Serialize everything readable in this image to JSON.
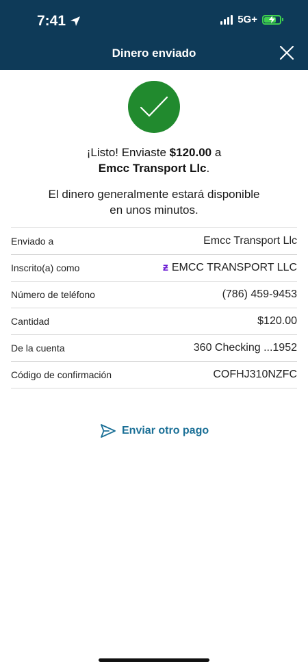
{
  "status_bar": {
    "time": "7:41",
    "network": "5G+",
    "icons": [
      "location-arrow-icon",
      "signal-icon",
      "battery-charging-icon"
    ]
  },
  "header": {
    "title": "Dinero enviado",
    "close_icon": "close-icon"
  },
  "confirmation": {
    "icon": "check-icon",
    "line1_prefix": "¡Listo! Enviaste ",
    "amount": "$120.00",
    "line1_suffix": " a",
    "recipient": "Emcc Transport Llc",
    "line2_suffix": ".",
    "availability_line1": "El dinero generalmente estará disponible",
    "availability_line2": "en unos minutos."
  },
  "details": [
    {
      "label": "Enviado a",
      "value": "Emcc Transport Llc"
    },
    {
      "label": "Inscrito(a) como",
      "value": "EMCC TRANSPORT LLC",
      "icon": "zelle-icon"
    },
    {
      "label": "Número de teléfono",
      "value": "(786) 459-9453"
    },
    {
      "label": "Cantidad",
      "value": "$120.00"
    },
    {
      "label": "De la cuenta",
      "value": "360 Checking ...1952"
    },
    {
      "label": "Código de confirmación",
      "value": "COFHJ310NZFC"
    }
  ],
  "actions": {
    "send_again_label": "Enviar otro pago",
    "send_again_icon": "send-icon"
  },
  "colors": {
    "header_bg": "#0e3a58",
    "success_green": "#218a2e",
    "link_blue": "#1a6f96",
    "zelle_purple": "#6d1ed4"
  }
}
